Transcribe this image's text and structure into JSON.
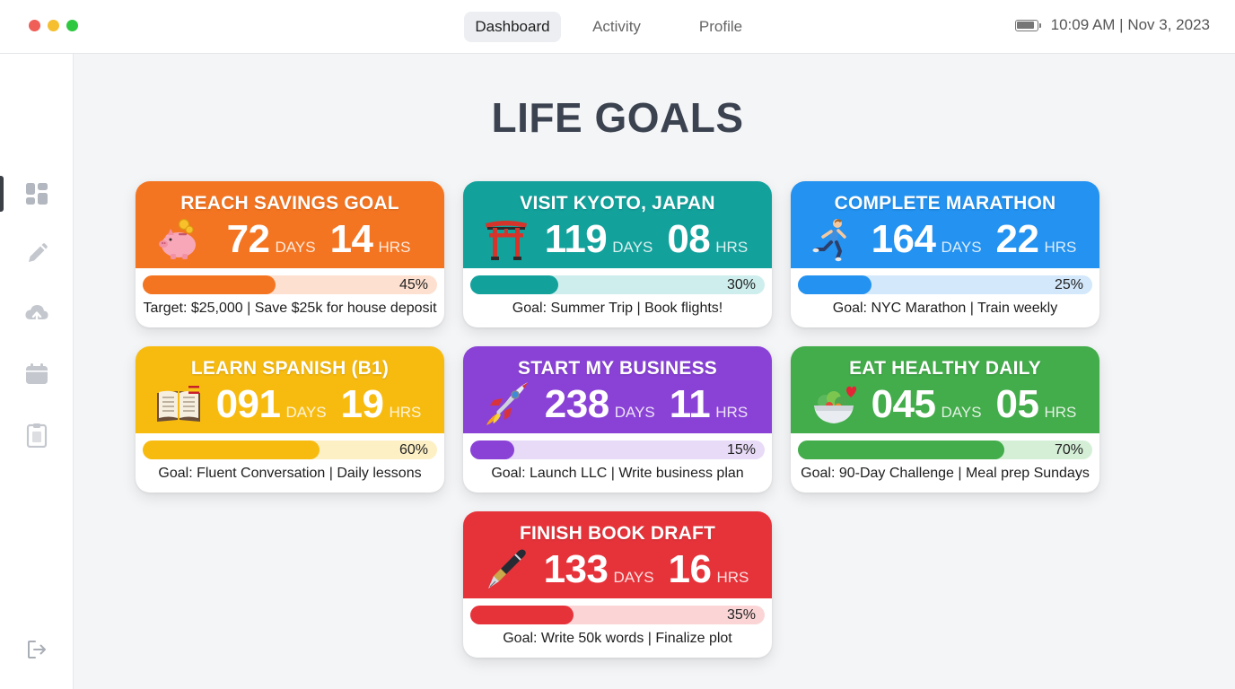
{
  "window": {
    "traffic_colors": [
      "#ef5e57",
      "#f5bf2f",
      "#2ec840"
    ]
  },
  "nav": {
    "tabs": [
      {
        "label": "Dashboard",
        "active": true
      },
      {
        "label": "Activity",
        "active": false
      },
      {
        "label": "Profile",
        "active": false
      }
    ]
  },
  "status": {
    "battery_level": 0.9,
    "datetime": "10:09 AM | Nov 3, 2023"
  },
  "sidebar": {
    "items": [
      {
        "icon": "dashboard-icon",
        "active": true
      },
      {
        "icon": "pencil-icon",
        "active": false
      },
      {
        "icon": "cloud-upload-icon",
        "active": false
      },
      {
        "icon": "calendar-icon",
        "active": false
      },
      {
        "icon": "clipboard-icon",
        "active": false
      }
    ],
    "logout_icon": "logout-icon"
  },
  "page": {
    "title": "LIFE GOALS"
  },
  "goals": [
    {
      "title": "REACH SAVINGS GOAL",
      "icon": "piggy-bank-icon",
      "days": "72",
      "days_unit": "DAYS",
      "hours": "14",
      "hours_unit": "HRS",
      "progress": 0.45,
      "progress_label": "45%",
      "description": "Target: $25,000 | Save $25k for house deposit",
      "color": "#f47521",
      "track_color": "#fde0cf"
    },
    {
      "title": "VISIT KYOTO, JAPAN",
      "icon": "torii-gate-icon",
      "days": "119",
      "days_unit": "DAYS",
      "hours": "08",
      "hours_unit": "HRS",
      "progress": 0.3,
      "progress_label": "30%",
      "description": "Goal: Summer Trip | Book flights!",
      "color": "#13a19c",
      "track_color": "#cdeeed"
    },
    {
      "title": "COMPLETE MARATHON",
      "icon": "runner-icon",
      "days": "164",
      "days_unit": "DAYS",
      "hours": "22",
      "hours_unit": "HRS",
      "progress": 0.25,
      "progress_label": "25%",
      "description": "Goal: NYC Marathon | Train weekly",
      "color": "#2392f0",
      "track_color": "#d3e8fb"
    },
    {
      "title": "LEARN SPANISH (B1)",
      "icon": "open-book-icon",
      "days": "091",
      "days_unit": "DAYS",
      "hours": "19",
      "hours_unit": "HRS",
      "progress": 0.6,
      "progress_label": "60%",
      "description": "Goal: Fluent Conversation | Daily lessons",
      "color": "#f7bb10",
      "track_color": "#fdf0c5"
    },
    {
      "title": "START MY BUSINESS",
      "icon": "rocket-icon",
      "days": "238",
      "days_unit": "DAYS",
      "hours": "11",
      "hours_unit": "HRS",
      "progress": 0.15,
      "progress_label": "15%",
      "description": "Goal: Launch LLC | Write business plan",
      "color": "#8a42d6",
      "track_color": "#e8dbf7"
    },
    {
      "title": "EAT HEALTHY DAILY",
      "icon": "salad-icon",
      "days": "045",
      "days_unit": "DAYS",
      "hours": "05",
      "hours_unit": "HRS",
      "progress": 0.7,
      "progress_label": "70%",
      "description": "Goal: 90-Day Challenge | Meal prep Sundays",
      "color": "#43ac4b",
      "track_color": "#d5efd7"
    },
    {
      "title": "FINISH BOOK DRAFT",
      "icon": "fountain-pen-icon",
      "days": "133",
      "days_unit": "DAYS",
      "hours": "16",
      "hours_unit": "HRS",
      "progress": 0.35,
      "progress_label": "35%",
      "description": "Goal: Write 50k words | Finalize plot",
      "color": "#e6333a",
      "track_color": "#fbd5d6"
    }
  ]
}
